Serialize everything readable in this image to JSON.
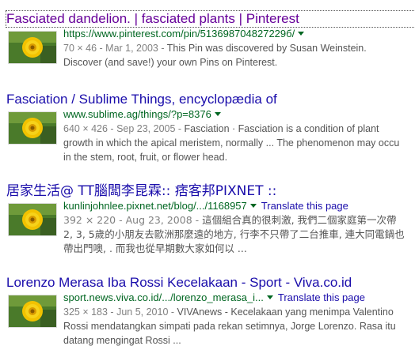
{
  "results": [
    {
      "title": "Fasciated dandelion. | fasciated plants | Pinterest",
      "url": "https://www.pinterest.com/pin/513698704827229б/",
      "translate": "",
      "meta": "70 × 46 - Mar 1, 2003 - ",
      "snippet_lines": [
        "This Pin was discovered by Susan Weinstein.",
        "Discover (and save!) your own Pins on Pinterest."
      ]
    },
    {
      "title": "Fasciation / Sublime Things, encyclopædia of",
      "url": "www.sublime.ag/things/?p=8376",
      "translate": "",
      "meta": "640 × 426 - Sep 23, 2005 - ",
      "snippet_lines": [
        "Fasciation · Fasciation is a condition of plant",
        "growth in which the apical meristem, normally ... The phenomenon may occu",
        "in the stem, root, fruit, or flower head."
      ]
    },
    {
      "title": "居家生活@ TT腦闆李昆霖:: 痞客邦PIXNET ::",
      "url": "kunlinjohnlee.pixnet.net/blog/.../1168957",
      "translate": "Translate this page",
      "meta": "392 × 220 - Aug 23, 2008 - ",
      "snippet_lines": [
        "這個組合真的很刺激, 我們二個家庭第一次帶",
        "2, 3, 5歲的小朋友去歐洲那麼遠的地方, 行李不只帶了二台推車, 連大同電鍋也",
        "帶出門噢, . 而我也從早期數大家如何以 ..."
      ]
    },
    {
      "title": "Lorenzo Merasa Iba Rossi Kecelakaan - Sport - Viva.co.id",
      "url": "sport.news.viva.co.id/.../lorenzo_merasa_i...",
      "translate": "Translate this page",
      "meta": "325 × 183 - Jun 5, 2010 - ",
      "snippet_lines": [
        "VIVAnews - Kecelakaan yang menimpa Valentino",
        "Rossi mendatangkan simpati pada rekan setimnya, Jorge Lorenzo. Rasa itu",
        "datang mengingat Rossi ..."
      ]
    }
  ],
  "colors": {
    "visited": "#660099",
    "link": "#1a0dab",
    "url": "#006621",
    "snippet": "#545454",
    "meta": "#808080"
  },
  "icons": {
    "thumbnail": "dandelion-thumbnail-icon",
    "dropdown": "chevron-down-icon"
  }
}
